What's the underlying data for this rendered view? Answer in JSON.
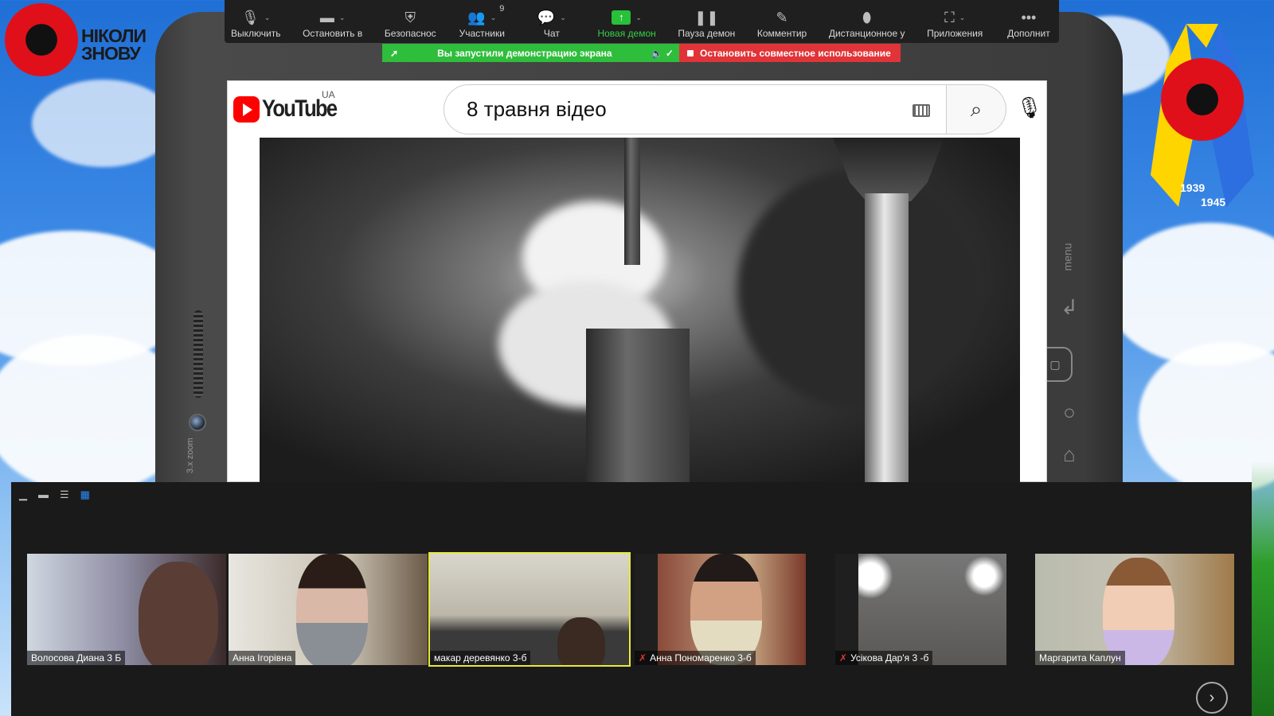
{
  "branding": {
    "left_logo_line1": "НІКОЛИ",
    "left_logo_line2": "ЗНОВУ",
    "ribbon_year_start": "1939",
    "ribbon_year_end": "1945"
  },
  "tablet": {
    "zoom_label": "3.x zoom",
    "menu_label": "menu"
  },
  "toolbar": {
    "items": [
      {
        "label": "Выключить",
        "icon": "microphone-icon"
      },
      {
        "label": "Остановить в",
        "icon": "video-camera-icon"
      },
      {
        "label": "Безопаснос",
        "icon": "shield-icon"
      },
      {
        "label": "Участники",
        "icon": "participants-icon",
        "count": "9"
      },
      {
        "label": "Чат",
        "icon": "chat-icon"
      },
      {
        "label": "Новая демон",
        "icon": "share-screen-icon"
      },
      {
        "label": "Пауза демон",
        "icon": "pause-icon"
      },
      {
        "label": "Комментир",
        "icon": "pencil-icon"
      },
      {
        "label": "Дистанционное у",
        "icon": "mouse-icon"
      },
      {
        "label": "Приложения",
        "icon": "apps-icon"
      },
      {
        "label": "Дополнит",
        "icon": "more-icon"
      }
    ]
  },
  "share_banner": {
    "status": "Вы запустили демонстрацию экрана",
    "stop_label": "Остановить совместное использование",
    "colors": {
      "status_bg": "#2fbd3c",
      "stop_bg": "#e13438"
    }
  },
  "youtube": {
    "brand": "YouTube",
    "region": "UA",
    "search_value": "8 травня відео"
  },
  "gallery": {
    "participants": [
      {
        "name": "Волосова Диана 3 Б",
        "muted": false
      },
      {
        "name": "Анна Ігорівна",
        "muted": false
      },
      {
        "name": "макар  деревянко 3-б",
        "muted": false,
        "selected": true
      },
      {
        "name": "Анна Пономаренко 3-б",
        "muted": true
      },
      {
        "name": "Усікова Дар'я 3 -б",
        "muted": true
      },
      {
        "name": "Маргарита Каплун",
        "muted": false
      }
    ]
  }
}
